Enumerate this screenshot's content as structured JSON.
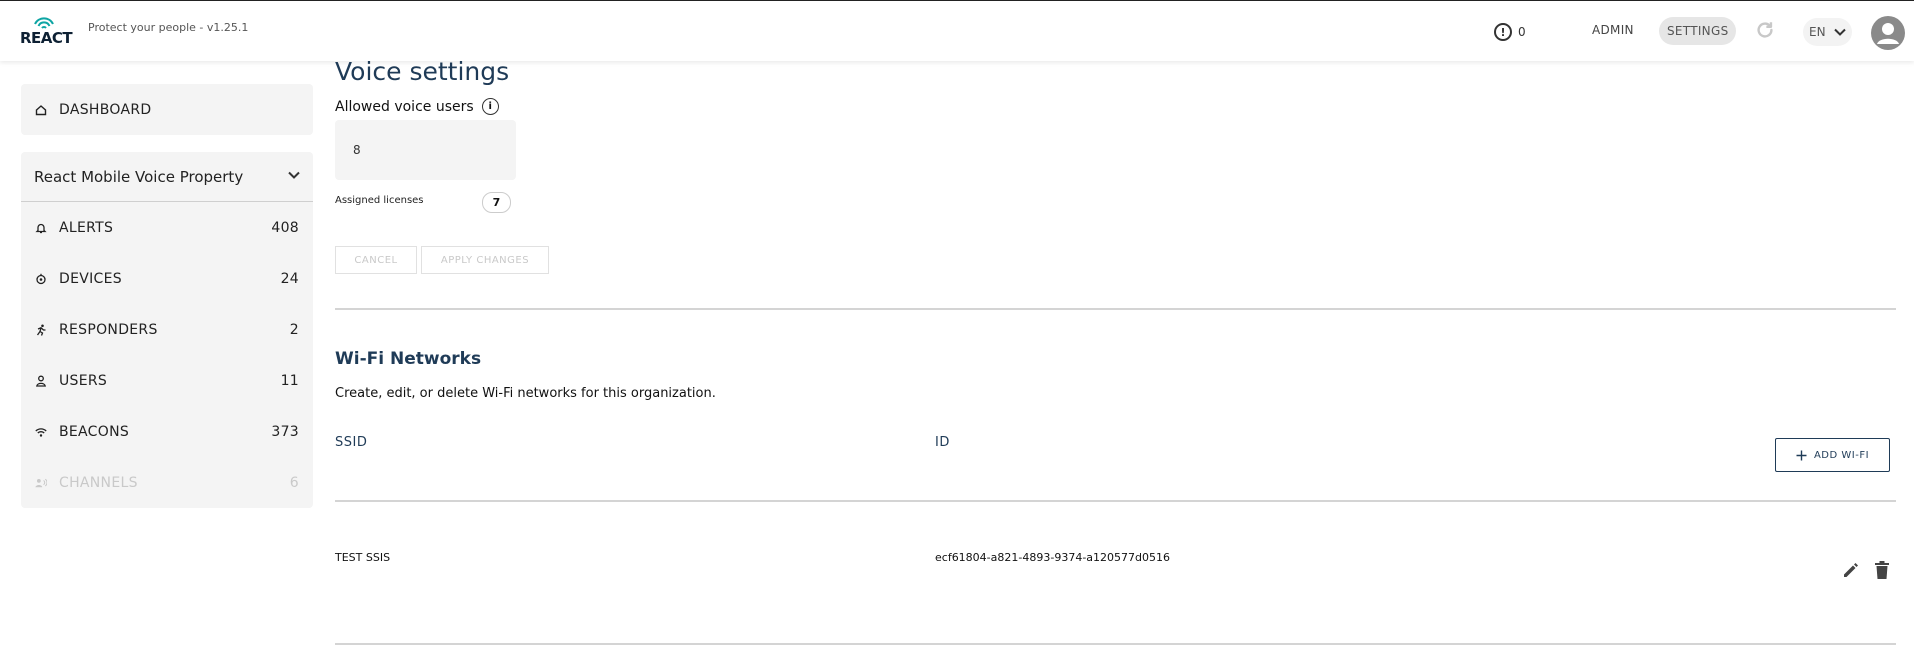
{
  "header": {
    "logo_text": "REACT",
    "version_text": "Protect your people - v1.25.1",
    "alert_count": "0",
    "nav": {
      "admin": "ADMIN",
      "settings": "SETTINGS"
    },
    "language": "EN"
  },
  "sidebar": {
    "dashboard": {
      "label": "DASHBOARD",
      "icon": "home-icon"
    },
    "property_selector": "React Mobile Voice Property",
    "items": [
      {
        "label": "ALERTS",
        "count": "408",
        "icon": "bell-icon"
      },
      {
        "label": "DEVICES",
        "count": "24",
        "icon": "device-icon"
      },
      {
        "label": "RESPONDERS",
        "count": "2",
        "icon": "runner-icon"
      },
      {
        "label": "USERS",
        "count": "11",
        "icon": "user-icon"
      },
      {
        "label": "BEACONS",
        "count": "373",
        "icon": "beacon-icon"
      },
      {
        "label": "CHANNELS",
        "count": "6",
        "icon": "voice-channel-icon",
        "disabled": true
      }
    ]
  },
  "voice_settings": {
    "title": "Voice settings",
    "allowed_label": "Allowed voice users",
    "allowed_value": "8",
    "assigned_label": "Assigned licenses",
    "assigned_value": "7",
    "cancel_label": "CANCEL",
    "apply_label": "APPLY CHANGES"
  },
  "wifi": {
    "title": "Wi-Fi Networks",
    "description": "Create, edit, or delete Wi-Fi networks for this organization.",
    "columns": {
      "ssid": "SSID",
      "id": "ID"
    },
    "add_label": "ADD WI-FI",
    "rows": [
      {
        "ssid": "TEST SSIS",
        "id": "ecf61804-a821-4893-9374-a120577d0516"
      }
    ]
  },
  "colors": {
    "accent": "#1f3b57",
    "sidebar_bg": "#f4f4f4",
    "disabled_text": "#c9c9c9"
  }
}
